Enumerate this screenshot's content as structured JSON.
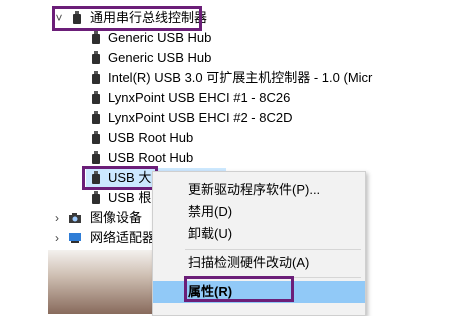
{
  "tree": {
    "category": "通用串行总线控制器",
    "devices": [
      "Generic USB Hub",
      "Generic USB Hub",
      "Intel(R) USB 3.0 可扩展主机控制器 - 1.0 (Micr",
      "LynxPoint USB EHCI #1 - 8C26",
      "LynxPoint USB EHCI #2 - 8C2D",
      "USB Root Hub",
      "USB Root Hub",
      "USB 大",
      "USB 根"
    ],
    "other_categories": [
      "图像设备",
      "网络适配器"
    ]
  },
  "context_menu": {
    "items": [
      "更新驱动程序软件(P)...",
      "禁用(D)",
      "卸载(U)",
      "扫描检测硬件改动(A)",
      "属性(R)"
    ]
  },
  "colors": {
    "highlight_border": "#6b1e78",
    "selection": "#cce8ff",
    "menu_active": "#91c9f7"
  },
  "icons": [
    "chevron-down-icon",
    "usb-plug-icon",
    "chevron-right-icon",
    "camera-icon",
    "network-adapter-icon"
  ]
}
